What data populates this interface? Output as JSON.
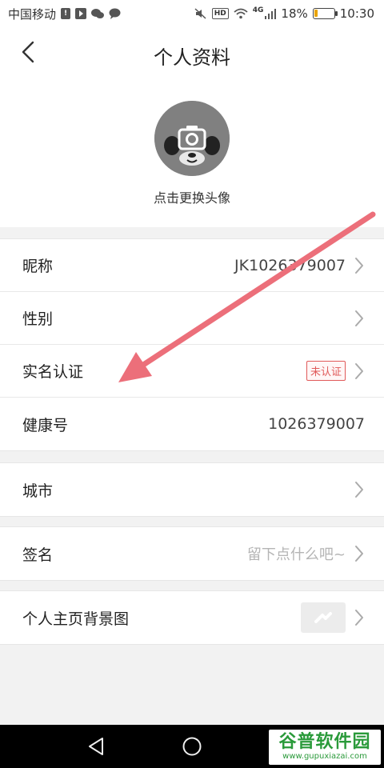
{
  "status_bar": {
    "carrier": "中国移动",
    "network": "4G",
    "hd": "HD",
    "battery_percent": "18%",
    "battery_level": 0.18,
    "time": "10:30"
  },
  "header": {
    "title": "个人资料",
    "back_icon": "chevron-left-icon"
  },
  "avatar": {
    "hint": "点击更换头像",
    "icon": "camera-icon"
  },
  "profile_rows": [
    {
      "label": "昵称",
      "value": "JK1026379007",
      "chevron": true
    },
    {
      "label": "性别",
      "value": "",
      "chevron": true
    },
    {
      "label": "实名认证",
      "badge": "未认证",
      "chevron": true
    },
    {
      "label": "健康号",
      "value": "1026379007",
      "chevron": false
    }
  ],
  "city_row": {
    "label": "城市"
  },
  "signature_row": {
    "label": "签名",
    "placeholder": "留下点什么吧~"
  },
  "background_row": {
    "label": "个人主页背景图"
  },
  "watermark": {
    "title": "谷普软件园",
    "url": "www.gupuxiazai.com"
  },
  "colors": {
    "accent_red": "#e05a5a",
    "annotation_arrow": "#ec6f7a",
    "battery": "#e8a300"
  }
}
